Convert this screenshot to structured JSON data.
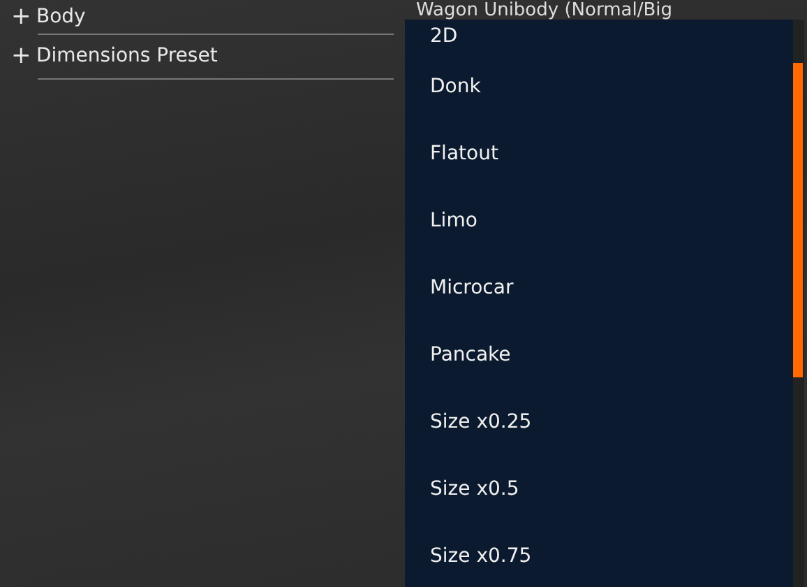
{
  "properties": [
    {
      "expander": "+",
      "label": "Body",
      "value": "Wagon Unibody (Normal/Big"
    },
    {
      "expander": "+",
      "label": "Dimensions Preset"
    }
  ],
  "dropdown": {
    "options": [
      {
        "label": "2D"
      },
      {
        "label": "Donk"
      },
      {
        "label": "Flatout"
      },
      {
        "label": "Limo"
      },
      {
        "label": "Microcar"
      },
      {
        "label": "Pancake"
      },
      {
        "label": "Size x0.25"
      },
      {
        "label": "Size x0.5"
      },
      {
        "label": "Size x0.75"
      }
    ]
  }
}
